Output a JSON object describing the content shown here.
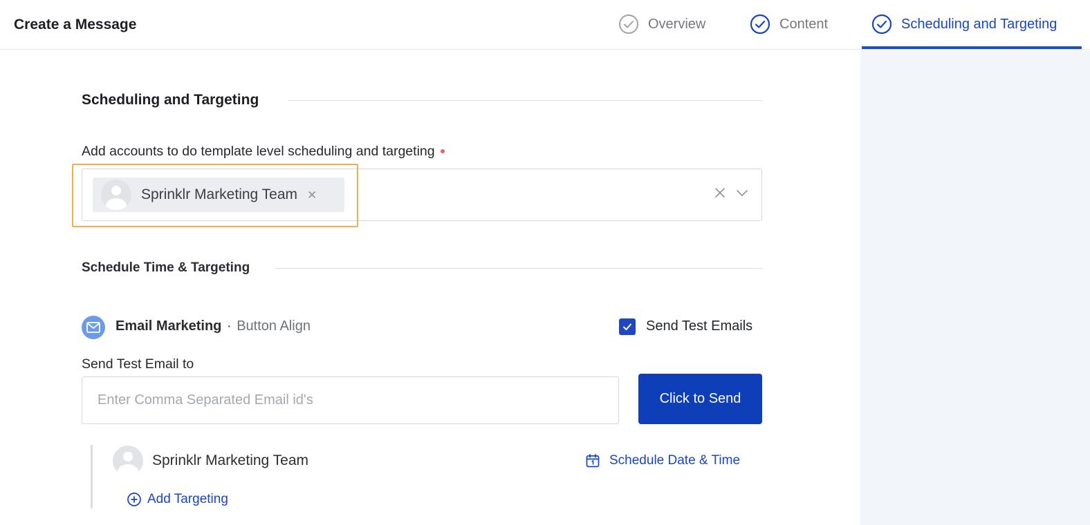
{
  "header": {
    "title": "Create a Message",
    "steps": [
      {
        "label": "Overview",
        "state": "complete",
        "icon": "check-circle-icon"
      },
      {
        "label": "Content",
        "state": "complete",
        "icon": "check-circle-icon"
      },
      {
        "label": "Scheduling and Targeting",
        "state": "active",
        "icon": "check-circle-icon"
      }
    ]
  },
  "colors": {
    "accent": "#1845c4",
    "primary_button": "#0e3eb8",
    "highlight": "#f2ad4c",
    "required": "#e0695b",
    "side_panel": "#f2f5fa"
  },
  "scheduling_section": {
    "title": "Scheduling and Targeting",
    "accounts_label": "Add accounts to do template level scheduling and targeting",
    "selected_accounts": [
      {
        "name": "Sprinklr Marketing Team",
        "icon": "user-avatar-icon"
      }
    ]
  },
  "schedule_time_section": {
    "title": "Schedule Time & Targeting",
    "channel": {
      "icon": "email-icon",
      "name": "Email Marketing",
      "separator": "·",
      "subtitle": "Button Align"
    },
    "send_test_checkbox": {
      "label": "Send Test Emails",
      "checked": true
    },
    "send_to_label": "Send Test Email to",
    "email_input": {
      "value": "",
      "placeholder": "Enter Comma Separated Email id's"
    },
    "send_button": "Click to Send",
    "targets": [
      {
        "account": "Sprinklr Marketing Team",
        "schedule_link": "Schedule Date & Time",
        "add_targeting": "Add Targeting"
      }
    ]
  }
}
